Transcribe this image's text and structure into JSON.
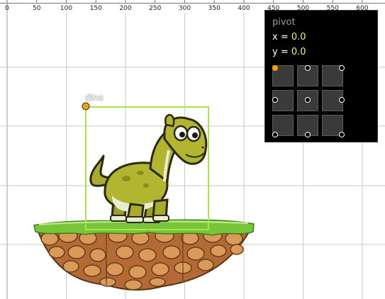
{
  "ruler": {
    "ticks": [
      "0",
      "50",
      "100",
      "150",
      "200",
      "250",
      "300",
      "350",
      "400",
      "450",
      "500",
      "550",
      "600"
    ]
  },
  "sprite": {
    "name": "dino",
    "selection_color": "#a8e34a",
    "anchor_color": "#f2a20c"
  },
  "pivot_panel": {
    "title": "pivot",
    "x_label": "x = ",
    "x_value": "0.0",
    "y_label": "y = ",
    "y_value": "0.0",
    "options": [
      {
        "name": "top-left",
        "selected": true
      },
      {
        "name": "top-center",
        "selected": false
      },
      {
        "name": "top-right",
        "selected": false
      },
      {
        "name": "middle-left",
        "selected": false
      },
      {
        "name": "center",
        "selected": false
      },
      {
        "name": "middle-right",
        "selected": false
      },
      {
        "name": "bottom-left",
        "selected": false
      },
      {
        "name": "bottom-center",
        "selected": false
      },
      {
        "name": "bottom-right",
        "selected": false
      }
    ]
  }
}
